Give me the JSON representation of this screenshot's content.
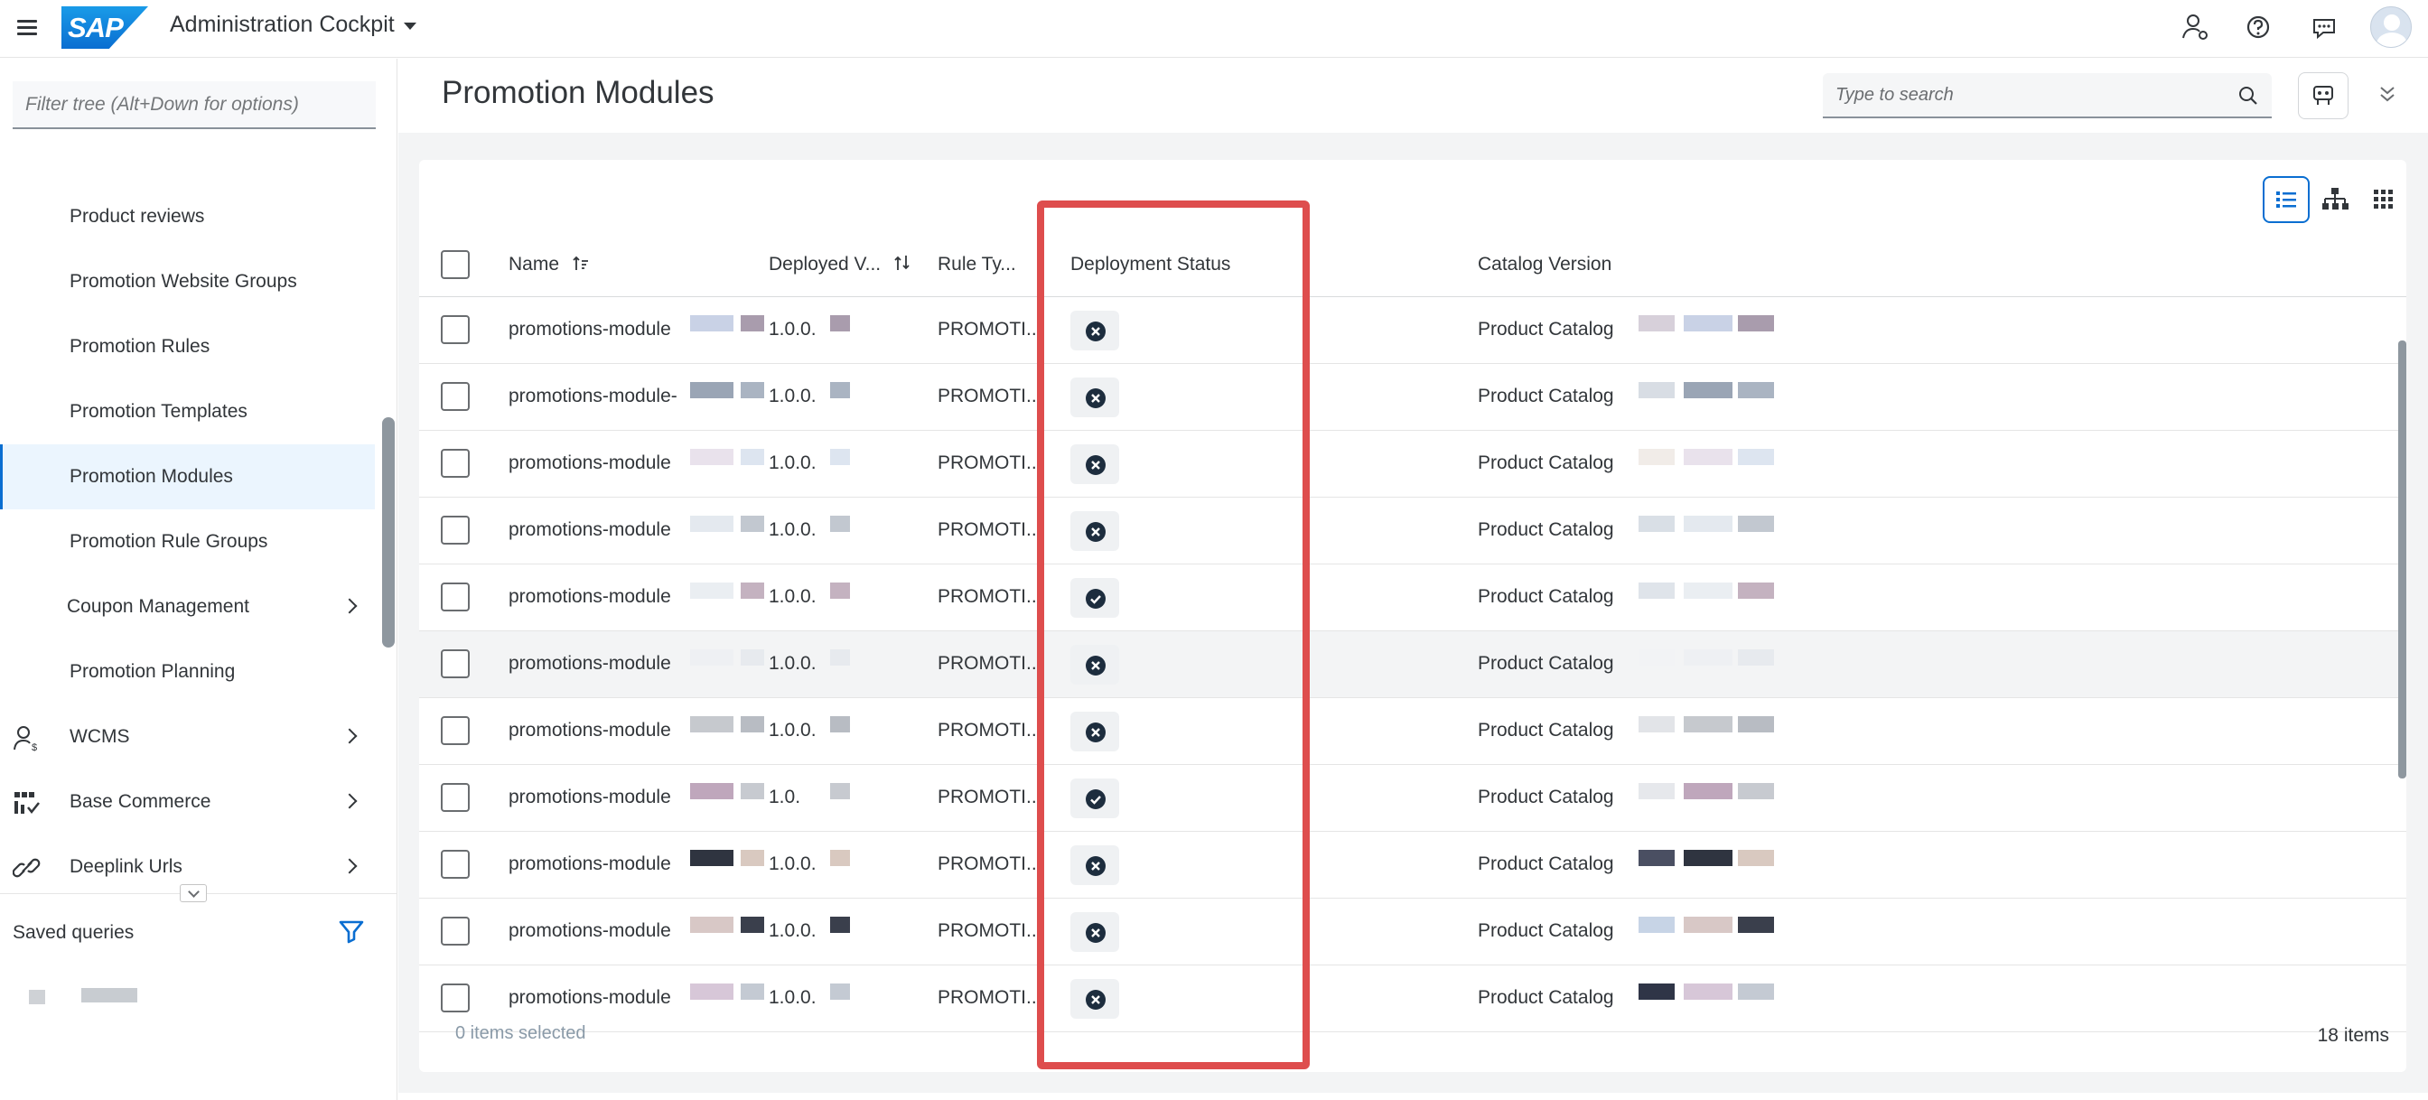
{
  "app": {
    "title": "Administration Cockpit",
    "logo_text": "SAP"
  },
  "nav": {
    "filter_placeholder": "Filter tree (Alt+Down for options)",
    "items": [
      {
        "label": "Product reviews"
      },
      {
        "label": "Promotion Website Groups"
      },
      {
        "label": "Promotion Rules"
      },
      {
        "label": "Promotion Templates"
      },
      {
        "label": "Promotion Modules",
        "selected": true
      },
      {
        "label": "Promotion Rule Groups"
      },
      {
        "label": "Coupon Management",
        "expandable": true
      },
      {
        "label": "Promotion Planning"
      },
      {
        "label": "WCMS",
        "icon": "customer-icon",
        "expandable": true
      },
      {
        "label": "Base Commerce",
        "icon": "base-commerce-icon",
        "expandable": true
      },
      {
        "label": "Deeplink Urls",
        "icon": "link-icon",
        "expandable": true
      }
    ],
    "saved_queries_label": "Saved queries"
  },
  "main": {
    "page_title": "Promotion Modules",
    "search_placeholder": "Type to search",
    "columns": {
      "name": "Name",
      "deployed_version": "Deployed V...",
      "rule_type": "Rule Ty...",
      "deployment_status": "Deployment Status",
      "catalog_version": "Catalog Version"
    },
    "rows": [
      {
        "name": "promotions-module",
        "version": "1.0.0.",
        "rule_type": "PROMOTI...",
        "status": "failed",
        "catalog": "Product Catalog"
      },
      {
        "name": "promotions-module-",
        "version": "1.0.0.",
        "rule_type": "PROMOTI...",
        "status": "failed",
        "catalog": "Product Catalog"
      },
      {
        "name": "promotions-module",
        "version": "1.0.0.",
        "rule_type": "PROMOTI...",
        "status": "failed",
        "catalog": "Product Catalog"
      },
      {
        "name": "promotions-module",
        "version": "1.0.0.",
        "rule_type": "PROMOTI...",
        "status": "failed",
        "catalog": "Product Catalog"
      },
      {
        "name": "promotions-module",
        "version": "1.0.0.",
        "rule_type": "PROMOTI...",
        "status": "deployed",
        "catalog": "Product Catalog"
      },
      {
        "name": "promotions-module",
        "version": "1.0.0.",
        "rule_type": "PROMOTI...",
        "status": "failed",
        "catalog": "Product Catalog"
      },
      {
        "name": "promotions-module",
        "version": "1.0.0.",
        "rule_type": "PROMOTI...",
        "status": "failed",
        "catalog": "Product Catalog"
      },
      {
        "name": "promotions-module",
        "version": "1.0.",
        "rule_type": "PROMOTI...",
        "status": "deployed",
        "catalog": "Product Catalog"
      },
      {
        "name": "promotions-module",
        "version": "1.0.0.",
        "rule_type": "PROMOTI...",
        "status": "failed",
        "catalog": "Product Catalog"
      },
      {
        "name": "promotions-module",
        "version": "1.0.0.",
        "rule_type": "PROMOTI...",
        "status": "failed",
        "catalog": "Product Catalog"
      },
      {
        "name": "promotions-module",
        "version": "1.0.0.",
        "rule_type": "PROMOTI...",
        "status": "failed",
        "catalog": "Product Catalog"
      }
    ],
    "selected_count_text": "0 items selected",
    "total_items_text": "18 items"
  },
  "colors": {
    "accent": "#0a6ed1",
    "highlight": "#de4d4d",
    "status_icon": "#1d2d3e"
  }
}
